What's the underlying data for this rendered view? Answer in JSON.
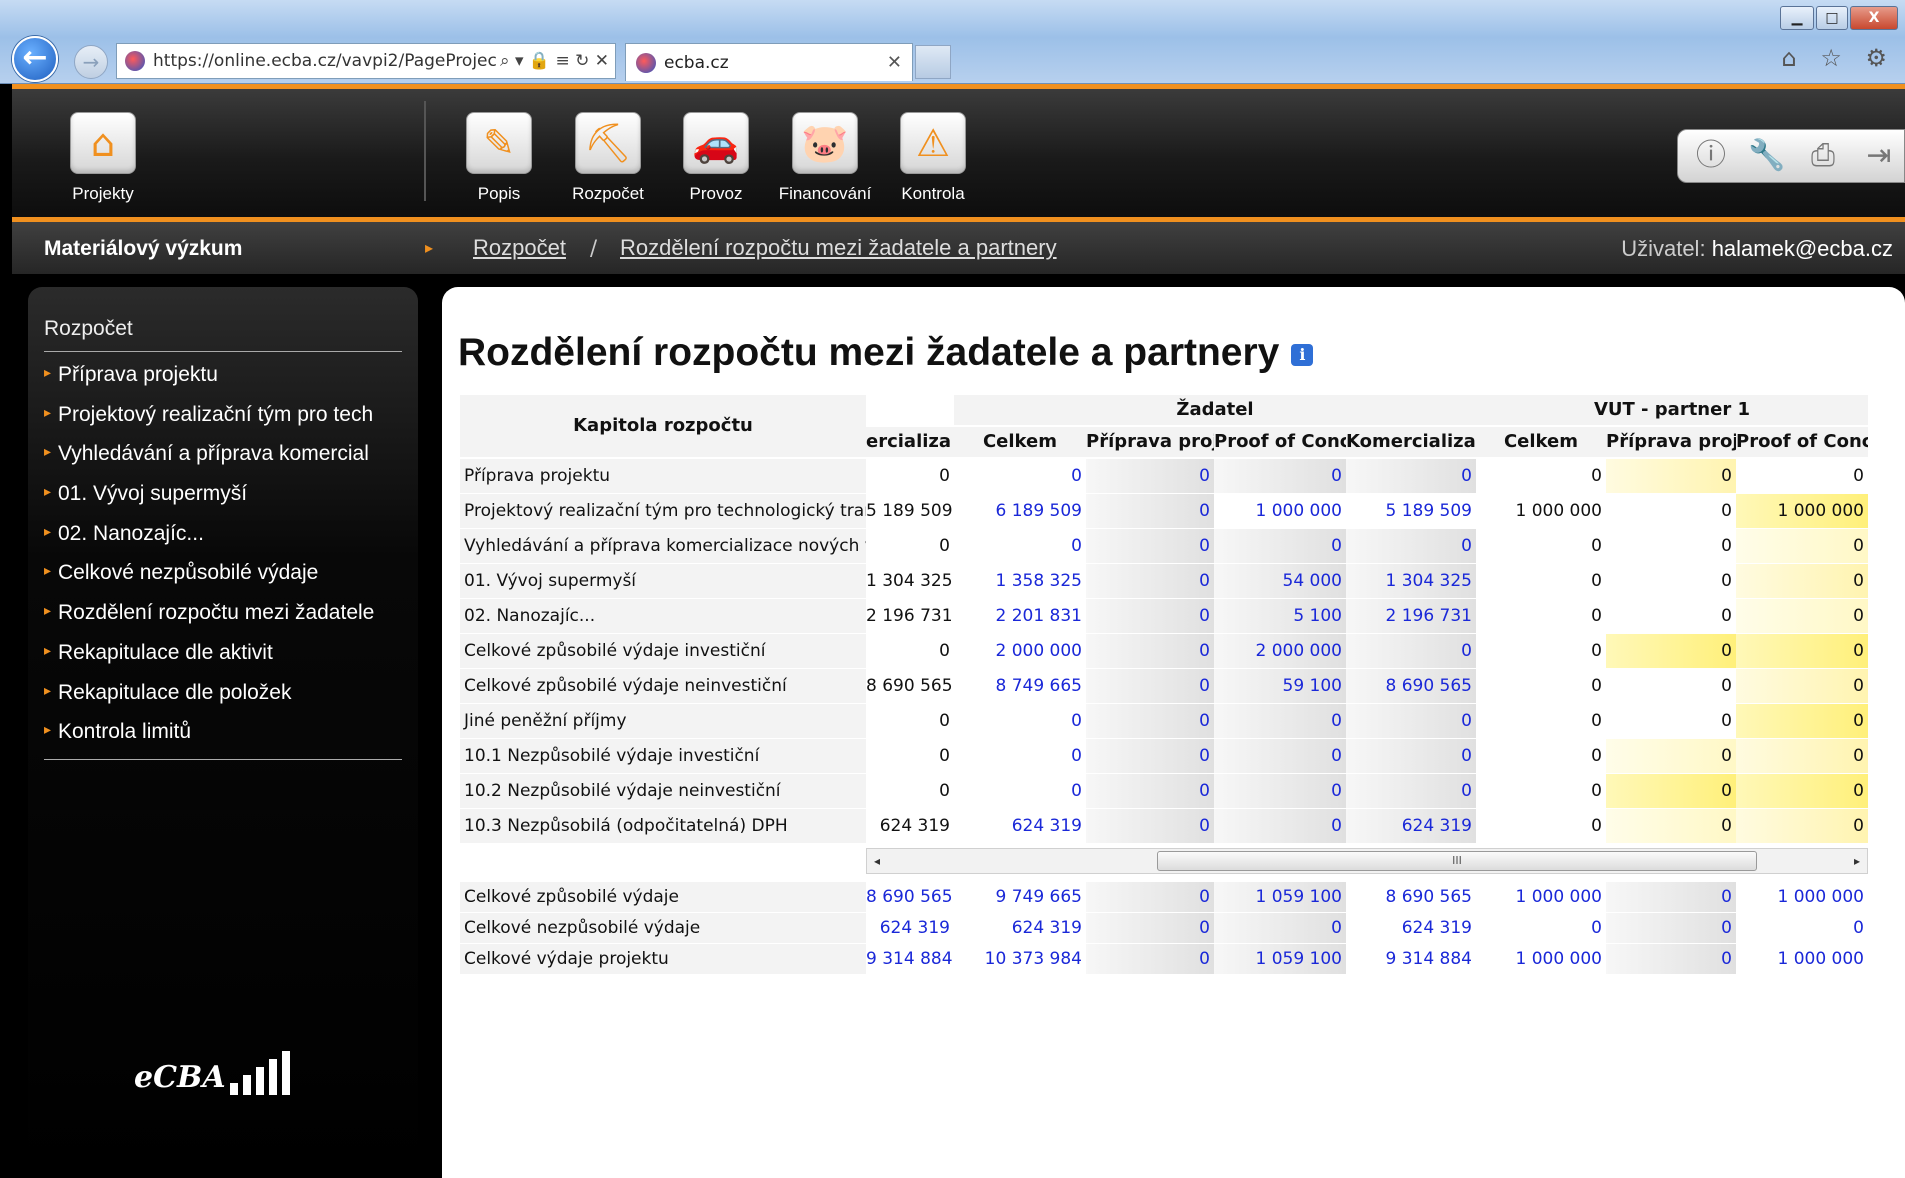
{
  "browser": {
    "url": "https://online.ecba.cz/vavpi2/PageProjec",
    "address_icons": "⌕ ▾ 🔒 ≡ ↻ ✕",
    "tab_title": "ecba.cz",
    "right_icons": "⌂ ☆ ⚙",
    "window_buttons": {
      "minimize": "▁",
      "maximize": "□",
      "close": "X"
    },
    "icons": {
      "back": "arrow-left-icon",
      "forward": "arrow-right-icon",
      "home": "home-icon",
      "favorites": "star-icon",
      "settings": "gear-icon"
    }
  },
  "header": {
    "nav": [
      {
        "label": "Projekty",
        "icon": "home-icon",
        "glyph": "⌂"
      },
      {
        "label": "Popis",
        "icon": "pencil-icon",
        "glyph": "✎"
      },
      {
        "label": "Rozpočet",
        "icon": "excavator-icon",
        "glyph": "⛏"
      },
      {
        "label": "Provoz",
        "icon": "car-icon",
        "glyph": "🚗"
      },
      {
        "label": "Financování",
        "icon": "piggy-bank-icon",
        "glyph": "🐷"
      },
      {
        "label": "Kontrola",
        "icon": "warning-icon",
        "glyph": "⚠"
      }
    ],
    "tools": [
      {
        "icon": "info-icon",
        "glyph": "ⓘ"
      },
      {
        "icon": "tools-icon",
        "glyph": "🔧"
      },
      {
        "icon": "print-icon",
        "glyph": "⎙"
      },
      {
        "icon": "logout-icon",
        "glyph": "⇥"
      }
    ],
    "accent_color": "#f0901f"
  },
  "breadcrumb": {
    "project": "Materiálový výzkum",
    "crumb1": "Rozpočet",
    "separator": "/",
    "crumb2": "Rozdělení rozpočtu mezi žadatele a partnery",
    "user_label": "Uživatel:",
    "user": "halamek@ecba.cz"
  },
  "sidebar": {
    "title": "Rozpočet",
    "items": [
      "Příprava projektu",
      "Projektový realizační tým pro tech",
      "Vyhledávání a příprava komercial",
      "01. Vývoj supermyší",
      "02. Nanozajíc...",
      "Celkové nezpůsobilé výdaje",
      "Rozdělení rozpočtu mezi žadatele",
      "Rekapitulace dle aktivit",
      "Rekapitulace dle položek",
      "Kontrola limitů"
    ],
    "logo_text": "eCBA"
  },
  "main": {
    "title": "Rozdělení rozpočtu mezi žadatele a partnery",
    "table": {
      "corner_header": "Kapitola rozpočtu",
      "group_headers": [
        "Žadatel",
        "VUT - partner 1"
      ],
      "columns": [
        "ercializa",
        "Celkem",
        "Příprava proj",
        "Proof of Conc",
        "Komercializa",
        "Celkem",
        "Příprava proj",
        "Proof of Conc"
      ],
      "rows": [
        {
          "label": "Příprava projektu",
          "values": [
            "0",
            "0",
            "0",
            "0",
            "0",
            "0",
            "0",
            "0"
          ]
        },
        {
          "label": "Projektový realizační tým pro technologický trar",
          "values": [
            "5 189 509",
            "6 189 509",
            "0",
            "1 000 000",
            "5 189 509",
            "1 000 000",
            "0",
            "1 000 000"
          ]
        },
        {
          "label": "Vyhledávání a příprava komercializace nových v",
          "values": [
            "0",
            "0",
            "0",
            "0",
            "0",
            "0",
            "0",
            "0"
          ]
        },
        {
          "label": "01. Vývoj supermyší",
          "values": [
            "1 304 325",
            "1 358 325",
            "0",
            "54 000",
            "1 304 325",
            "0",
            "0",
            "0"
          ]
        },
        {
          "label": "02. Nanozajíc...",
          "values": [
            "2 196 731",
            "2 201 831",
            "0",
            "5 100",
            "2 196 731",
            "0",
            "0",
            "0"
          ]
        },
        {
          "label": "Celkové způsobilé výdaje investiční",
          "values": [
            "0",
            "2 000 000",
            "0",
            "2 000 000",
            "0",
            "0",
            "0",
            "0"
          ]
        },
        {
          "label": "Celkové způsobilé výdaje neinvestiční",
          "values": [
            "8 690 565",
            "8 749 665",
            "0",
            "59 100",
            "8 690 565",
            "0",
            "0",
            "0"
          ]
        },
        {
          "label": "Jiné peněžní příjmy",
          "values": [
            "0",
            "0",
            "0",
            "0",
            "0",
            "0",
            "0",
            "0"
          ]
        },
        {
          "label": "10.1 Nezpůsobilé výdaje investiční",
          "values": [
            "0",
            "0",
            "0",
            "0",
            "0",
            "0",
            "0",
            "0"
          ]
        },
        {
          "label": "10.2 Nezpůsobilé výdaje neinvestiční",
          "values": [
            "0",
            "0",
            "0",
            "0",
            "0",
            "0",
            "0",
            "0"
          ]
        },
        {
          "label": "10.3 Nezpůsobilá (odpočitatelná) DPH",
          "values": [
            "624 319",
            "624 319",
            "0",
            "0",
            "624 319",
            "0",
            "0",
            "0"
          ]
        }
      ],
      "totals": [
        {
          "label": "Celkové způsobilé výdaje",
          "values": [
            "8 690 565",
            "9 749 665",
            "0",
            "1 059 100",
            "8 690 565",
            "1 000 000",
            "0",
            "1 000 000"
          ]
        },
        {
          "label": "Celkové nezpůsobilé výdaje",
          "values": [
            "624 319",
            "624 319",
            "0",
            "0",
            "624 319",
            "0",
            "0",
            "0"
          ]
        },
        {
          "label": "Celkové výdaje projektu",
          "values": [
            "9 314 884",
            "10 373 984",
            "0",
            "1 059 100",
            "9 314 884",
            "1 000 000",
            "0",
            "1 000 000"
          ]
        }
      ],
      "scrollbar": {
        "left": "◂",
        "right": "▸",
        "thumb": "III"
      }
    }
  }
}
